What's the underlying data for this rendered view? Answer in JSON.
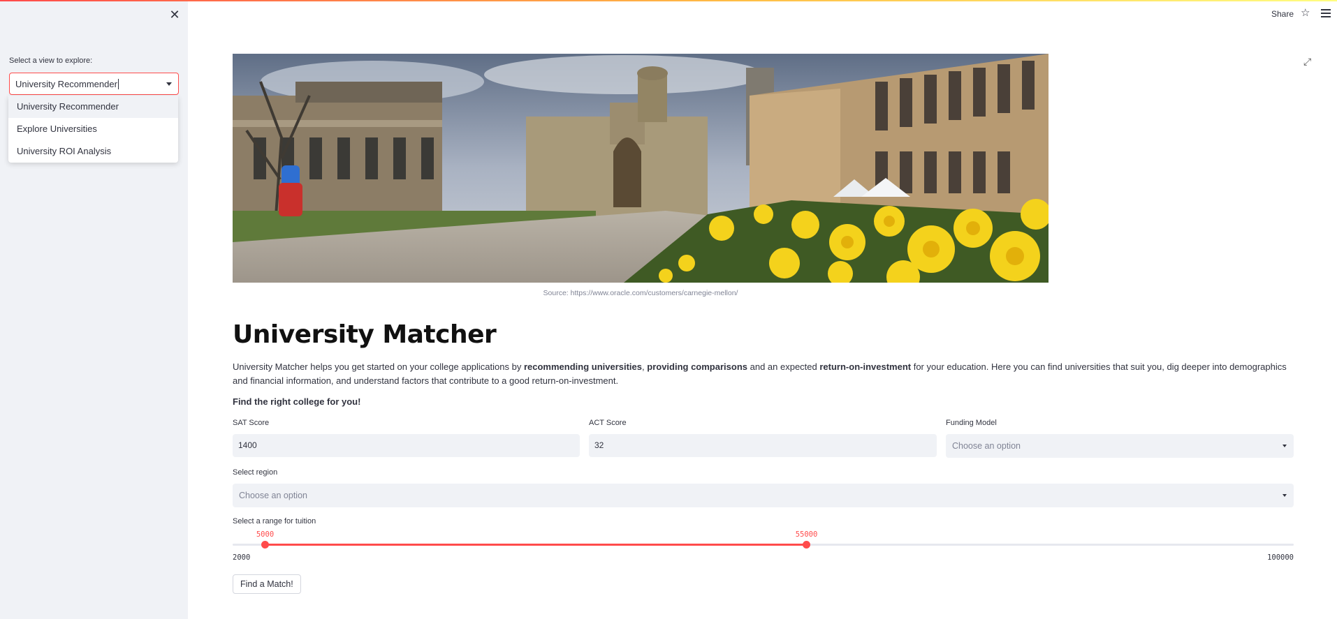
{
  "sidebar": {
    "select_label": "Select a view to explore:",
    "selected_value": "University Recommender",
    "options": [
      "University Recommender",
      "Explore Universities",
      "University ROI Analysis"
    ]
  },
  "header": {
    "share_label": "Share"
  },
  "hero": {
    "caption": "Source: https://www.oracle.com/customers/carnegie-mellon/"
  },
  "main": {
    "title": "University Matcher",
    "intro_parts": [
      "University Matcher helps you get started on your college applications by ",
      "recommending universities",
      ", ",
      "providing comparisons",
      " and an expected ",
      "return-on-investment",
      " for your education. Here you can find universities that suit you, dig deeper into demographics and financial information, and understand factors that contribute to a good return-on-investment."
    ],
    "subheading": "Find the right college for you!",
    "sat": {
      "label": "SAT Score",
      "value": "1400"
    },
    "act": {
      "label": "ACT Score",
      "value": "32"
    },
    "funding": {
      "label": "Funding Model",
      "placeholder": "Choose an option"
    },
    "region": {
      "label": "Select region",
      "placeholder": "Choose an option"
    },
    "tuition": {
      "label": "Select a range for tuition",
      "min": 2000,
      "max": 100000,
      "low": 5000,
      "high": 55000,
      "min_label": "2000",
      "max_label": "100000",
      "low_label": "5000",
      "high_label": "55000"
    },
    "button_label": "Find a Match!"
  },
  "colors": {
    "accent": "#ff4b4b",
    "sidebar_bg": "#f0f2f6",
    "input_bg": "#f0f2f6"
  }
}
